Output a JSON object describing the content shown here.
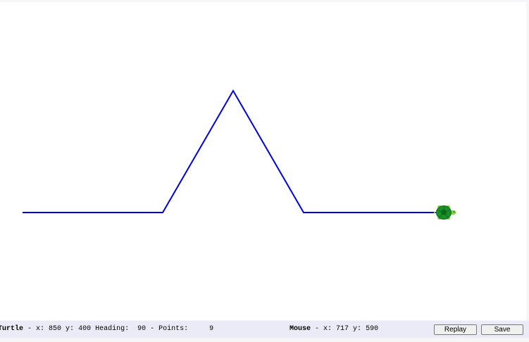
{
  "canvas": {
    "line_color": "#0000dd",
    "background": "#ffffff",
    "turtle_icon": "turtle-icon",
    "turtle_colors": {
      "shell": "#1a8f2a",
      "shell_pattern": "#0d6a1c",
      "body": "#8bd33c"
    }
  },
  "status": {
    "turtle_label": "Turtle",
    "turtle_x": "850",
    "turtle_y": "400",
    "heading": "90",
    "points": "9",
    "mouse_label": "Mouse",
    "mouse_x": "717",
    "mouse_y": "590",
    "bar_color": "#ebebf7"
  },
  "buttons": {
    "replay_label": "Replay",
    "save_label": "Save"
  }
}
